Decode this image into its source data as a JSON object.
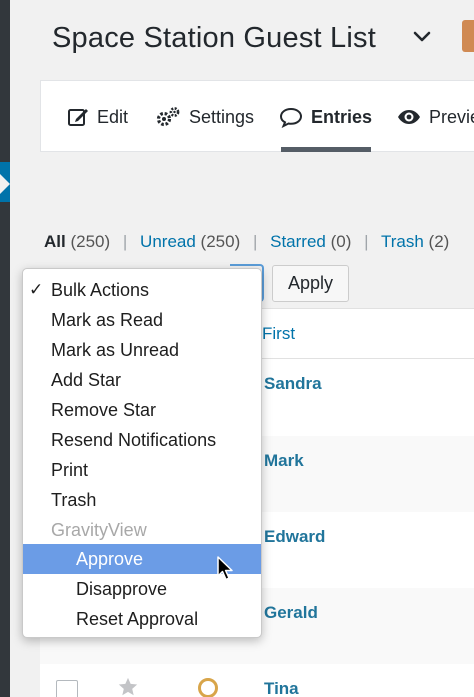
{
  "page": {
    "title": "Space Station Guest List"
  },
  "toolbar": {
    "items": [
      {
        "label": "Edit",
        "icon": "edit-icon"
      },
      {
        "label": "Settings",
        "icon": "gear-icon"
      },
      {
        "label": "Entries",
        "icon": "comment-icon",
        "active": true
      },
      {
        "label": "Previe",
        "icon": "eye-icon"
      }
    ]
  },
  "filters": {
    "all": {
      "label": "All",
      "count": "(250)"
    },
    "unread": {
      "label": "Unread",
      "count": "(250)"
    },
    "starred": {
      "label": "Starred",
      "count": "(0)"
    },
    "trash": {
      "label": "Trash",
      "count": "(2)"
    },
    "separator": "|"
  },
  "bulk": {
    "apply_label": "Apply",
    "checkmark": "✓",
    "options": [
      {
        "label": "Bulk Actions",
        "checked": true
      },
      {
        "label": "Mark as Read"
      },
      {
        "label": "Mark as Unread"
      },
      {
        "label": "Add Star"
      },
      {
        "label": "Remove Star"
      },
      {
        "label": "Resend Notifications"
      },
      {
        "label": "Print"
      },
      {
        "label": "Trash"
      },
      {
        "label": "GravityView",
        "group": true
      },
      {
        "label": "Approve",
        "sub": true,
        "highlighted": true
      },
      {
        "label": "Disapprove",
        "sub": true
      },
      {
        "label": "Reset Approval",
        "sub": true
      }
    ]
  },
  "table": {
    "column_first": "First",
    "rows": [
      {
        "first": "Sandra"
      },
      {
        "first": "Mark"
      },
      {
        "first": "Edward"
      },
      {
        "first": "Gerald"
      },
      {
        "first": "Tina"
      }
    ]
  },
  "colors": {
    "link": "#0073aa",
    "highlight": "#6b9ce6",
    "admin_bar": "#32373c",
    "approval_icon": "#d8a54a"
  }
}
